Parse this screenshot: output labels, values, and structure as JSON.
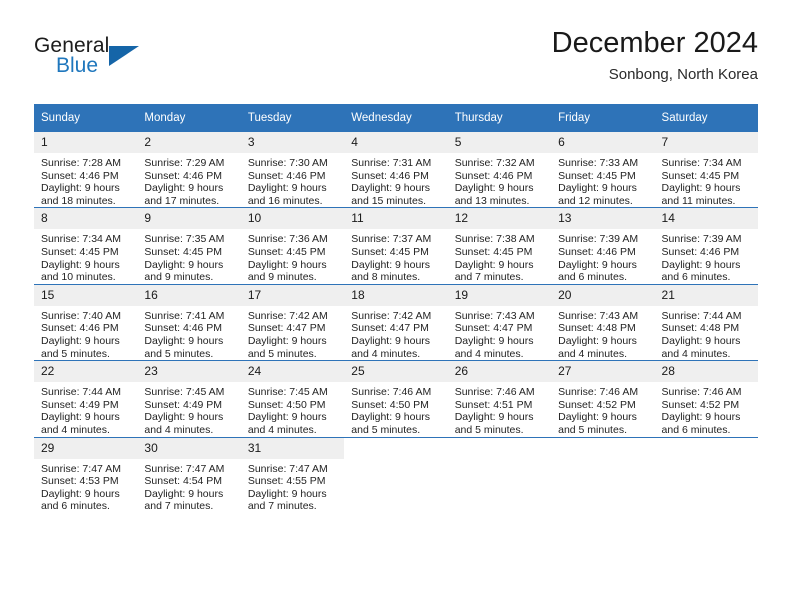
{
  "brand": {
    "name_part1": "General",
    "name_part2": "Blue",
    "triangle_color": "#1565a8",
    "blue_color": "#1f77bd"
  },
  "header": {
    "title": "December 2024",
    "subtitle": "Sonbong, North Korea"
  },
  "theme": {
    "header_bg": "#2e73b8",
    "daynum_bg": "#efefef",
    "row_divider": "#2e73b8",
    "text": "#1a1a1a"
  },
  "weekday_headers": [
    "Sunday",
    "Monday",
    "Tuesday",
    "Wednesday",
    "Thursday",
    "Friday",
    "Saturday"
  ],
  "labels": {
    "sunrise_prefix": "Sunrise:",
    "sunset_prefix": "Sunset:",
    "daylight_prefix": "Daylight:"
  },
  "weeks": [
    [
      {
        "day": "1",
        "l1": "Sunrise: 7:28 AM",
        "l2": "Sunset: 4:46 PM",
        "l3": "Daylight: 9 hours",
        "l4": "and 18 minutes."
      },
      {
        "day": "2",
        "l1": "Sunrise: 7:29 AM",
        "l2": "Sunset: 4:46 PM",
        "l3": "Daylight: 9 hours",
        "l4": "and 17 minutes."
      },
      {
        "day": "3",
        "l1": "Sunrise: 7:30 AM",
        "l2": "Sunset: 4:46 PM",
        "l3": "Daylight: 9 hours",
        "l4": "and 16 minutes."
      },
      {
        "day": "4",
        "l1": "Sunrise: 7:31 AM",
        "l2": "Sunset: 4:46 PM",
        "l3": "Daylight: 9 hours",
        "l4": "and 15 minutes."
      },
      {
        "day": "5",
        "l1": "Sunrise: 7:32 AM",
        "l2": "Sunset: 4:46 PM",
        "l3": "Daylight: 9 hours",
        "l4": "and 13 minutes."
      },
      {
        "day": "6",
        "l1": "Sunrise: 7:33 AM",
        "l2": "Sunset: 4:45 PM",
        "l3": "Daylight: 9 hours",
        "l4": "and 12 minutes."
      },
      {
        "day": "7",
        "l1": "Sunrise: 7:34 AM",
        "l2": "Sunset: 4:45 PM",
        "l3": "Daylight: 9 hours",
        "l4": "and 11 minutes."
      }
    ],
    [
      {
        "day": "8",
        "l1": "Sunrise: 7:34 AM",
        "l2": "Sunset: 4:45 PM",
        "l3": "Daylight: 9 hours",
        "l4": "and 10 minutes."
      },
      {
        "day": "9",
        "l1": "Sunrise: 7:35 AM",
        "l2": "Sunset: 4:45 PM",
        "l3": "Daylight: 9 hours",
        "l4": "and 9 minutes."
      },
      {
        "day": "10",
        "l1": "Sunrise: 7:36 AM",
        "l2": "Sunset: 4:45 PM",
        "l3": "Daylight: 9 hours",
        "l4": "and 9 minutes."
      },
      {
        "day": "11",
        "l1": "Sunrise: 7:37 AM",
        "l2": "Sunset: 4:45 PM",
        "l3": "Daylight: 9 hours",
        "l4": "and 8 minutes."
      },
      {
        "day": "12",
        "l1": "Sunrise: 7:38 AM",
        "l2": "Sunset: 4:45 PM",
        "l3": "Daylight: 9 hours",
        "l4": "and 7 minutes."
      },
      {
        "day": "13",
        "l1": "Sunrise: 7:39 AM",
        "l2": "Sunset: 4:46 PM",
        "l3": "Daylight: 9 hours",
        "l4": "and 6 minutes."
      },
      {
        "day": "14",
        "l1": "Sunrise: 7:39 AM",
        "l2": "Sunset: 4:46 PM",
        "l3": "Daylight: 9 hours",
        "l4": "and 6 minutes."
      }
    ],
    [
      {
        "day": "15",
        "l1": "Sunrise: 7:40 AM",
        "l2": "Sunset: 4:46 PM",
        "l3": "Daylight: 9 hours",
        "l4": "and 5 minutes."
      },
      {
        "day": "16",
        "l1": "Sunrise: 7:41 AM",
        "l2": "Sunset: 4:46 PM",
        "l3": "Daylight: 9 hours",
        "l4": "and 5 minutes."
      },
      {
        "day": "17",
        "l1": "Sunrise: 7:42 AM",
        "l2": "Sunset: 4:47 PM",
        "l3": "Daylight: 9 hours",
        "l4": "and 5 minutes."
      },
      {
        "day": "18",
        "l1": "Sunrise: 7:42 AM",
        "l2": "Sunset: 4:47 PM",
        "l3": "Daylight: 9 hours",
        "l4": "and 4 minutes."
      },
      {
        "day": "19",
        "l1": "Sunrise: 7:43 AM",
        "l2": "Sunset: 4:47 PM",
        "l3": "Daylight: 9 hours",
        "l4": "and 4 minutes."
      },
      {
        "day": "20",
        "l1": "Sunrise: 7:43 AM",
        "l2": "Sunset: 4:48 PM",
        "l3": "Daylight: 9 hours",
        "l4": "and 4 minutes."
      },
      {
        "day": "21",
        "l1": "Sunrise: 7:44 AM",
        "l2": "Sunset: 4:48 PM",
        "l3": "Daylight: 9 hours",
        "l4": "and 4 minutes."
      }
    ],
    [
      {
        "day": "22",
        "l1": "Sunrise: 7:44 AM",
        "l2": "Sunset: 4:49 PM",
        "l3": "Daylight: 9 hours",
        "l4": "and 4 minutes."
      },
      {
        "day": "23",
        "l1": "Sunrise: 7:45 AM",
        "l2": "Sunset: 4:49 PM",
        "l3": "Daylight: 9 hours",
        "l4": "and 4 minutes."
      },
      {
        "day": "24",
        "l1": "Sunrise: 7:45 AM",
        "l2": "Sunset: 4:50 PM",
        "l3": "Daylight: 9 hours",
        "l4": "and 4 minutes."
      },
      {
        "day": "25",
        "l1": "Sunrise: 7:46 AM",
        "l2": "Sunset: 4:50 PM",
        "l3": "Daylight: 9 hours",
        "l4": "and 5 minutes."
      },
      {
        "day": "26",
        "l1": "Sunrise: 7:46 AM",
        "l2": "Sunset: 4:51 PM",
        "l3": "Daylight: 9 hours",
        "l4": "and 5 minutes."
      },
      {
        "day": "27",
        "l1": "Sunrise: 7:46 AM",
        "l2": "Sunset: 4:52 PM",
        "l3": "Daylight: 9 hours",
        "l4": "and 5 minutes."
      },
      {
        "day": "28",
        "l1": "Sunrise: 7:46 AM",
        "l2": "Sunset: 4:52 PM",
        "l3": "Daylight: 9 hours",
        "l4": "and 6 minutes."
      }
    ],
    [
      {
        "day": "29",
        "l1": "Sunrise: 7:47 AM",
        "l2": "Sunset: 4:53 PM",
        "l3": "Daylight: 9 hours",
        "l4": "and 6 minutes."
      },
      {
        "day": "30",
        "l1": "Sunrise: 7:47 AM",
        "l2": "Sunset: 4:54 PM",
        "l3": "Daylight: 9 hours",
        "l4": "and 7 minutes."
      },
      {
        "day": "31",
        "l1": "Sunrise: 7:47 AM",
        "l2": "Sunset: 4:55 PM",
        "l3": "Daylight: 9 hours",
        "l4": "and 7 minutes."
      },
      {
        "day": "",
        "l1": "",
        "l2": "",
        "l3": "",
        "l4": ""
      },
      {
        "day": "",
        "l1": "",
        "l2": "",
        "l3": "",
        "l4": ""
      },
      {
        "day": "",
        "l1": "",
        "l2": "",
        "l3": "",
        "l4": ""
      },
      {
        "day": "",
        "l1": "",
        "l2": "",
        "l3": "",
        "l4": ""
      }
    ]
  ]
}
